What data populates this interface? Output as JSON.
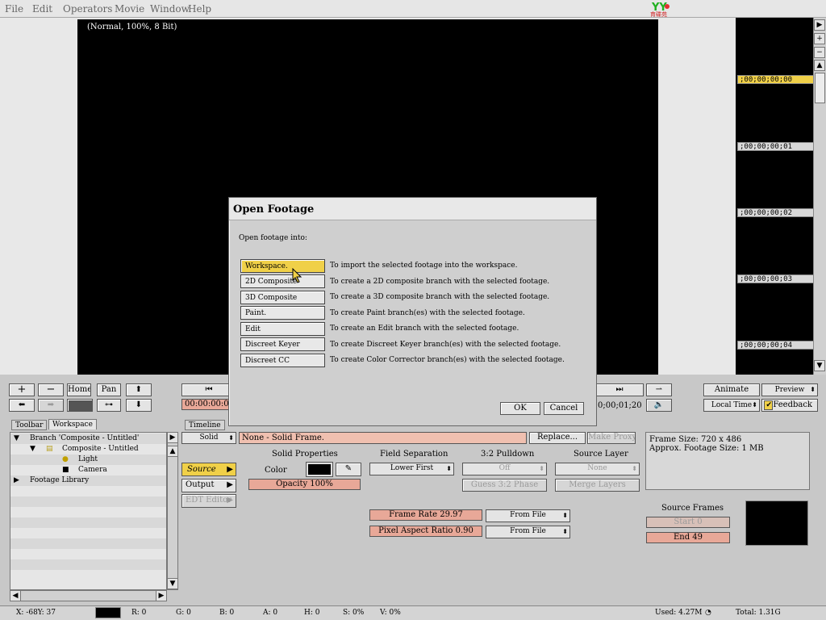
{
  "menu": [
    "File",
    "Edit",
    "Operators",
    "Movie",
    "Window",
    "Help"
  ],
  "logo_text": "育碟苑",
  "viewer": {
    "status": "(Normal, 100%, 8 Bit)"
  },
  "timecodes": [
    ";00;00;00;00",
    ";00;00;00;01",
    ";00;00;00;02",
    ";00;00;00;03",
    ";00;00;00;04"
  ],
  "nav": {
    "home": "Home",
    "pan": "Pan"
  },
  "transport": {
    "timecode_left": "00:00:00:0",
    "timecode_right": "0;00;01;20"
  },
  "right_controls": {
    "animate": "Animate",
    "preview": "Preview",
    "local_time": "Local Time",
    "feedback": "Feedback"
  },
  "dialog": {
    "title": "Open Footage",
    "prompt": "Open footage into:",
    "options": [
      {
        "label": "Workspace.",
        "desc": "To import the selected footage into the workspace."
      },
      {
        "label": "2D Composite",
        "desc": "To create a 2D composite branch with the selected footage."
      },
      {
        "label": "3D Composite",
        "desc": "To create a 3D composite branch with the selected footage."
      },
      {
        "label": "Paint.",
        "desc": "To create Paint branch(es) with the selected footage."
      },
      {
        "label": "Edit",
        "desc": "To create an Edit branch with the selected footage."
      },
      {
        "label": "Discreet Keyer",
        "desc": "To create Discreet Keyer branch(es) with the selected footage."
      },
      {
        "label": "Discreet CC",
        "desc": "To create Color Corrector branch(es) with the selected footage."
      }
    ],
    "ok": "OK",
    "cancel": "Cancel"
  },
  "tabs": {
    "toolbar": "Toolbar",
    "workspace": "Workspace",
    "timeline": "Timeline"
  },
  "tree": [
    {
      "label": "Branch 'Composite - Untitled'"
    },
    {
      "label": "Composite - Untitled"
    },
    {
      "label": "Light"
    },
    {
      "label": "Camera"
    },
    {
      "label": "Footage Library"
    }
  ],
  "props": {
    "solid_dd": "Solid",
    "name_field": "None - Solid Frame.",
    "replace": "Replace...",
    "make_proxy": "Make Proxy.",
    "source": "Source",
    "output": "Output",
    "edit_editor": "EDT Editor",
    "solid_properties": "Solid Properties",
    "color": "Color",
    "opacity": "Opacity 100%",
    "field_separation": "Field Separation",
    "lower_first": "Lower First",
    "pulldown": "3:2 Pulldown",
    "off": "Off",
    "guess_phase": "Guess 3:2 Phase",
    "source_layer": "Source Layer",
    "none": "None",
    "merge_layers": "Merge Layers",
    "frame_rate": "Frame Rate 29.97",
    "pixel_aspect": "Pixel Aspect Ratio 0.90",
    "from_file_1": "From File",
    "from_file_2": "From File"
  },
  "info": {
    "frame_size": "Frame Size: 720 x 486",
    "footage_size": "Approx. Footage Size:   1 MB"
  },
  "source_frames": {
    "title": "Source Frames",
    "start": "Start 0",
    "end": "End 49"
  },
  "status": {
    "x": "X:  -68Y:  37",
    "r": "R: 0",
    "g": "G: 0",
    "b": "B: 0",
    "a": "A: 0",
    "h": "H: 0",
    "s": "S: 0%",
    "v": "V: 0%",
    "used": "Used: 4.27M",
    "total": "Total: 1.31G"
  }
}
